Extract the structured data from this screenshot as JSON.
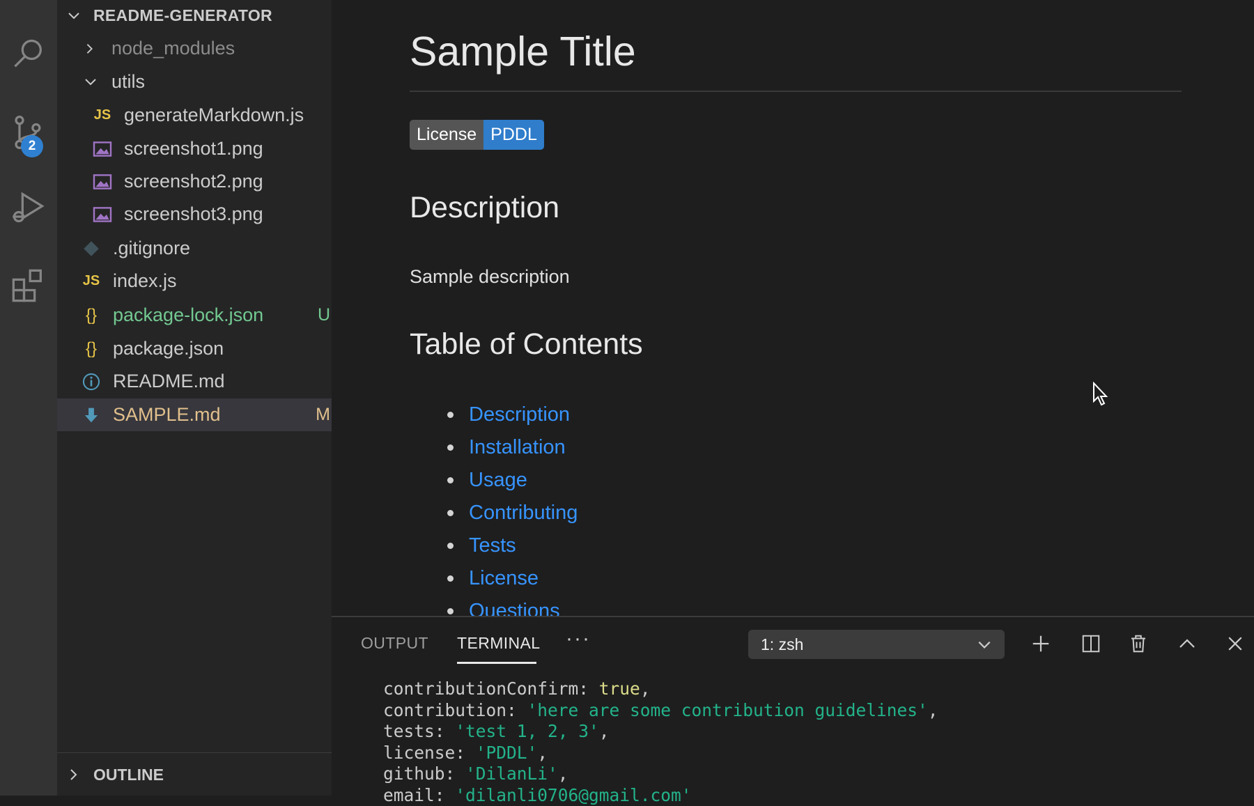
{
  "sidebar": {
    "project": "README-GENERATOR",
    "items": [
      {
        "label": "node_modules",
        "type": "folder-collapsed",
        "git": ""
      },
      {
        "label": "utils",
        "type": "folder-expanded",
        "git": ""
      },
      {
        "label": "generateMarkdown.js",
        "type": "js",
        "git": ""
      },
      {
        "label": "screenshot1.png",
        "type": "image",
        "git": ""
      },
      {
        "label": "screenshot2.png",
        "type": "image",
        "git": ""
      },
      {
        "label": "screenshot3.png",
        "type": "image",
        "git": ""
      },
      {
        "label": ".gitignore",
        "type": "git",
        "git": ""
      },
      {
        "label": "index.js",
        "type": "js",
        "git": ""
      },
      {
        "label": "package-lock.json",
        "type": "json",
        "git": "U"
      },
      {
        "label": "package.json",
        "type": "json",
        "git": ""
      },
      {
        "label": "README.md",
        "type": "info",
        "git": ""
      },
      {
        "label": "SAMPLE.md",
        "type": "markdown",
        "git": "M"
      }
    ],
    "outline": "OUTLINE"
  },
  "activity": {
    "source_control_badge": "2",
    "icons": [
      "search-icon",
      "source-control-icon",
      "run-debug-icon",
      "extensions-icon"
    ]
  },
  "preview": {
    "title": "Sample Title",
    "badge_left": "License",
    "badge_right": "PDDL",
    "description_heading": "Description",
    "description_text": "Sample description",
    "toc_heading": "Table of Contents",
    "toc": [
      "Description",
      "Installation",
      "Usage",
      "Contributing",
      "Tests",
      "License",
      "Questions"
    ]
  },
  "panel": {
    "tabs": [
      "OUTPUT",
      "TERMINAL"
    ],
    "active_tab": "TERMINAL",
    "more": "···",
    "terminal_select": "1: zsh",
    "terminal_lines": [
      {
        "key": "contributionConfirm: ",
        "value": "true",
        "kind": "bool",
        "suffix": ","
      },
      {
        "key": "contribution: ",
        "value": "'here are some contribution guidelines'",
        "kind": "str",
        "suffix": ","
      },
      {
        "key": "tests: ",
        "value": "'test 1, 2, 3'",
        "kind": "str",
        "suffix": ","
      },
      {
        "key": "license: ",
        "value": "'PDDL'",
        "kind": "str",
        "suffix": ","
      },
      {
        "key": "github: ",
        "value": "'DilanLi'",
        "kind": "str",
        "suffix": ","
      },
      {
        "key": "email: ",
        "value": "'dilanli0706@gmail.com'",
        "kind": "str",
        "suffix": ""
      }
    ]
  },
  "colors": {
    "accent": "#3794ff",
    "untracked": "#73c991",
    "modified": "#e2c08d",
    "badge_blue": "#2f7dcb"
  }
}
